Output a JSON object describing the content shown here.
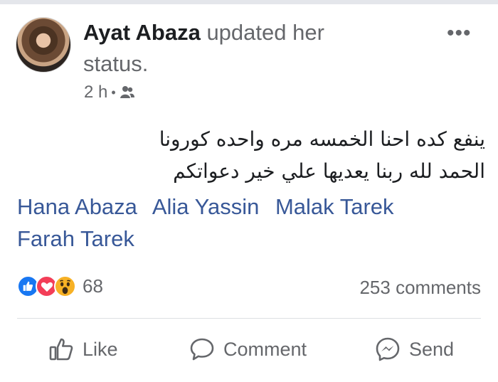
{
  "post": {
    "author": "Ayat Abaza",
    "action_text": "updated her status.",
    "time": "2 h",
    "separator": "•",
    "privacy_icon": "friends-icon",
    "more_icon": "•••",
    "text_lines": [
      "ينفع كده احنا الخمسه مره واحده كورونا",
      "الحمد لله ربنا يعديها علي خير دعواتكم"
    ],
    "tags": [
      "Hana Abaza",
      "Alia Yassin",
      "Malak Tarek",
      "Farah Tarek"
    ],
    "reactions": {
      "icons": [
        "like-reaction-icon",
        "love-reaction-icon",
        "wow-reaction-icon"
      ],
      "count": "68"
    },
    "comments_count": "253 comments"
  },
  "actions": {
    "like": "Like",
    "comment": "Comment",
    "send": "Send"
  },
  "colors": {
    "accent": "#385898",
    "muted": "#65676b",
    "like": "#1877f2",
    "love": "#f33e58",
    "wow": "#f7b125"
  }
}
